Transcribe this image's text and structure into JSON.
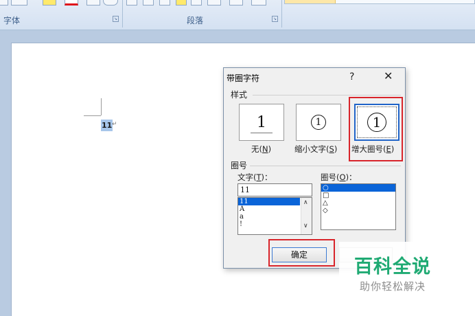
{
  "ribbon": {
    "font_group_label": "字体",
    "paragraph_group_label": "段落"
  },
  "document": {
    "text": "11",
    "paragraph_mark": "↵"
  },
  "dialog": {
    "title": "带圈字符",
    "help": "?",
    "close": "✕",
    "style_section_label": "样式",
    "styles": [
      {
        "preview": "1",
        "label": "无",
        "hotkey": "N"
      },
      {
        "preview": "1",
        "label": "缩小文字",
        "hotkey": "S"
      },
      {
        "preview": "1",
        "label": "增大圈号",
        "hotkey": "E"
      }
    ],
    "selected_style_index": 2,
    "enclosure_section_label": "圈号",
    "text_field_label": "文字",
    "text_field_hotkey": "T",
    "text_field_value": "11",
    "text_list": [
      "11",
      "A",
      "a",
      "!"
    ],
    "text_list_selected_index": 0,
    "enclosure_field_label": "圈号",
    "enclosure_field_hotkey": "O",
    "enclosure_list": [
      "○",
      "□",
      "△",
      "◇"
    ],
    "enclosure_list_selected_index": 0,
    "ok_button": "确定"
  },
  "watermark": {
    "title": "百科全说",
    "subtitle": "助你轻松解决"
  },
  "colors": {
    "selection_blue": "#0a64d8",
    "highlight_red": "#d8242a",
    "watermark_green": "#1faa73"
  }
}
